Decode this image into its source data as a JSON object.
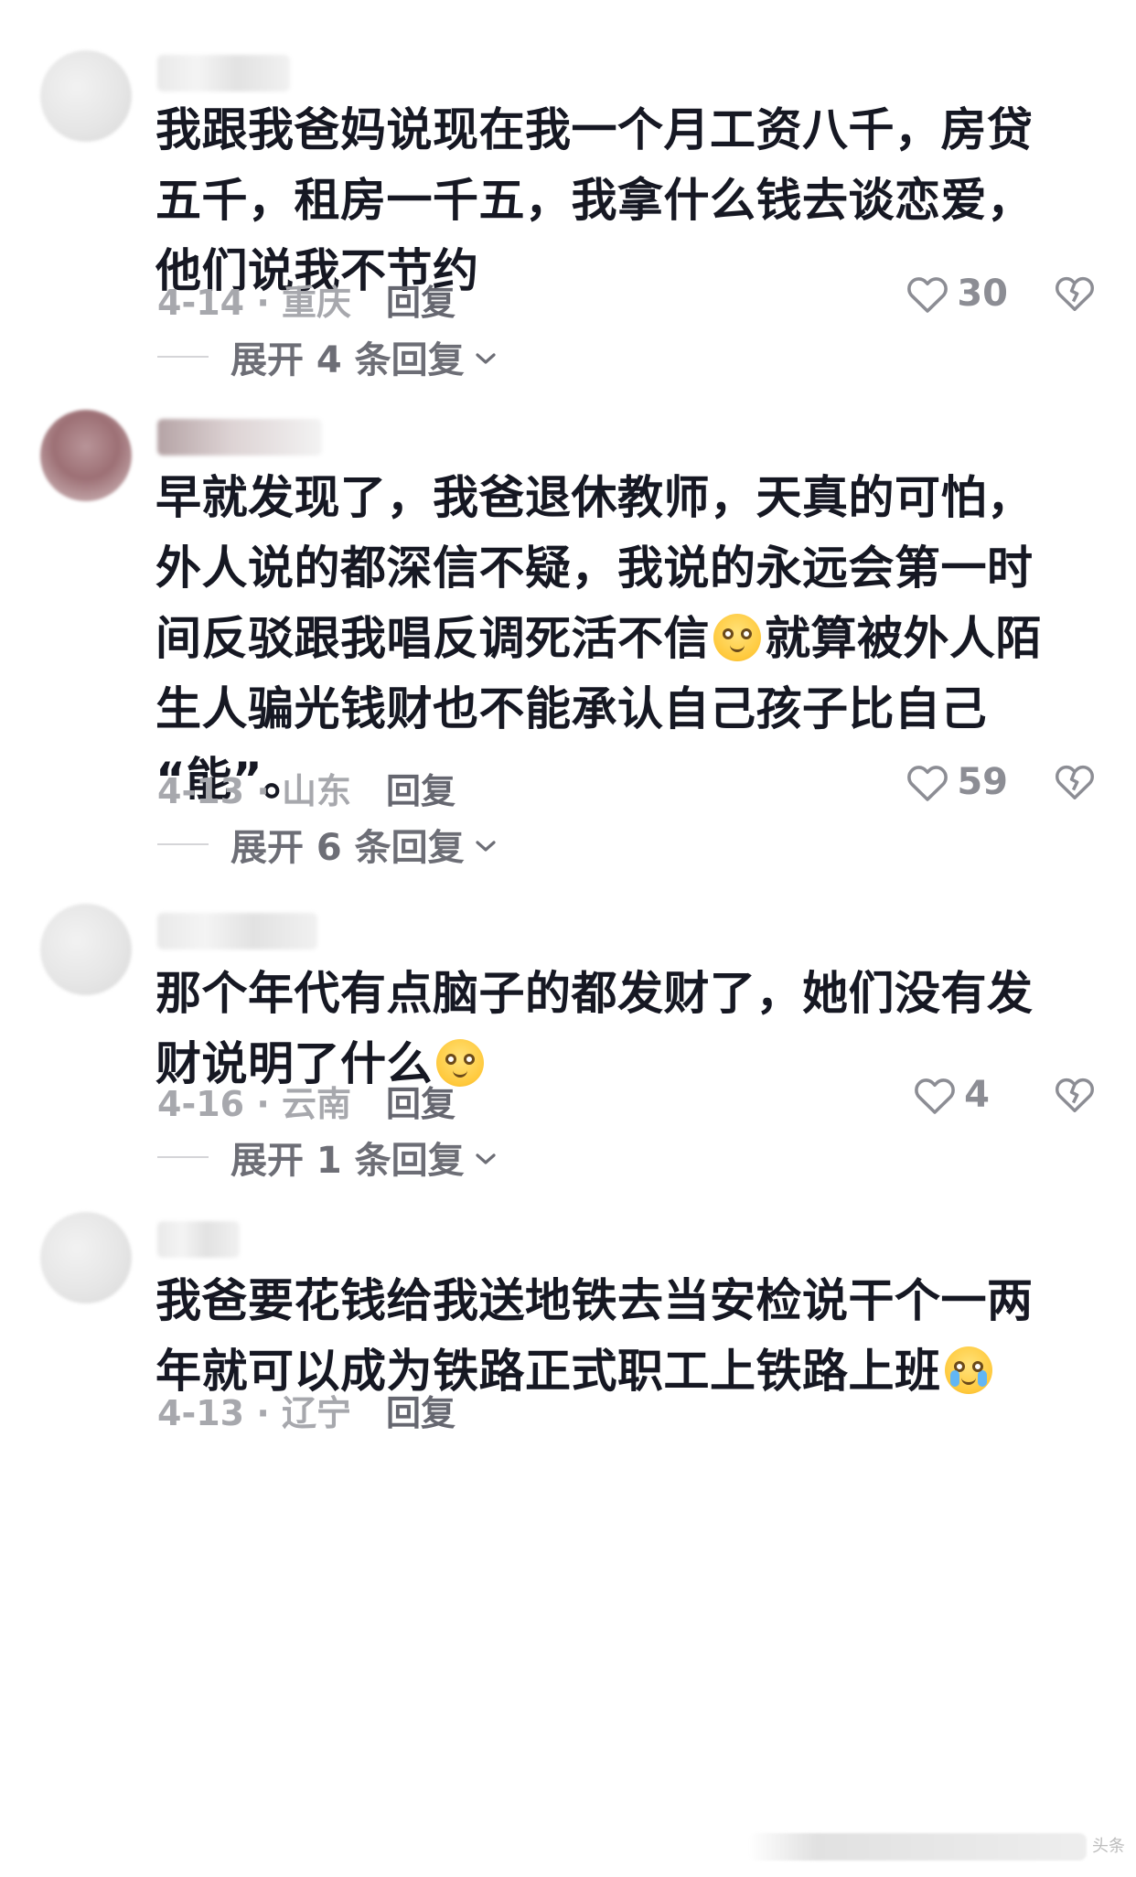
{
  "comments": [
    {
      "lines": [
        "我跟我爸妈说现在我一个月工资八千，房贷",
        "五千，租房一千五，我拿什么钱去谈恋爱，",
        "他们说我不节约"
      ],
      "date_location": "4-14 · 重庆",
      "reply_label": "回复",
      "likes": "30",
      "expand_label": "展开 4 条回复"
    },
    {
      "lines": [
        "早就发现了，我爸退休教师，天真的可怕，",
        "外人说的都深信不疑，我说的永远会第一时",
        "间反驳跟我唱反调死活不信",
        "就算被外人陌",
        "生人骗光钱财也不能承认自己孩子比自己",
        "“能”。"
      ],
      "date_location": "4-13 · 山东",
      "reply_label": "回复",
      "likes": "59",
      "expand_label": "展开 6 条回复"
    },
    {
      "lines": [
        "那个年代有点脑子的都发财了，她们没有发",
        "财说明了什么"
      ],
      "date_location": "4-16 · 云南",
      "reply_label": "回复",
      "likes": "4",
      "expand_label": "展开 1 条回复"
    },
    {
      "lines": [
        "我爸要花钱给我送地铁去当安检说干个一两",
        "年就可以成为铁路正式职工上铁路上班"
      ],
      "date_location": "4-13 · 辽宁",
      "reply_label": "回复"
    }
  ],
  "icons": {
    "like": "heart-outline-icon",
    "dislike": "broken-heart-icon",
    "expand": "chevron-down-icon",
    "emoji_smile": "smirk-emoji-icon",
    "emoji_cry": "crying-emoji-icon"
  },
  "colors": {
    "text": "#161823",
    "meta": "#a7a8ad",
    "reply": "#666770",
    "expand": "#6d6e76"
  },
  "watermark": "头条"
}
